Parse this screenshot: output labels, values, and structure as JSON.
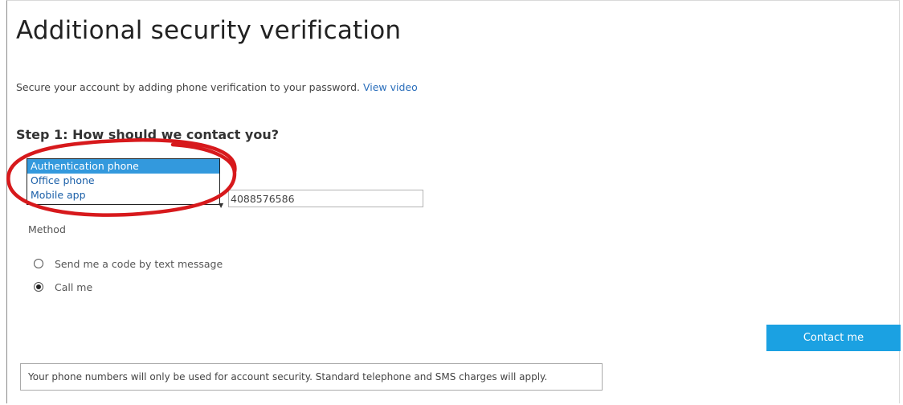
{
  "page": {
    "title": "Additional security verification",
    "subtitle": "Secure your account by adding phone verification to your password.",
    "view_video_link": "View video"
  },
  "step1": {
    "heading": "Step 1: How should we contact you?",
    "contact_options": [
      "Authentication phone",
      "Office phone",
      "Mobile app"
    ],
    "selected_option": "Authentication phone",
    "phone_number": "4088576586",
    "method_label": "Method",
    "methods": [
      {
        "label": "Send me a code by text message",
        "checked": false
      },
      {
        "label": "Call me",
        "checked": true
      }
    ]
  },
  "actions": {
    "contact_button": "Contact me"
  },
  "notice": "Your phone numbers will only be used for account security. Standard telephone and SMS charges will apply.",
  "colors": {
    "accent": "#1ba1e2",
    "selected_option_bg": "#3399dd",
    "link": "#2a6ebb",
    "annotation_circle": "#d7191c"
  }
}
